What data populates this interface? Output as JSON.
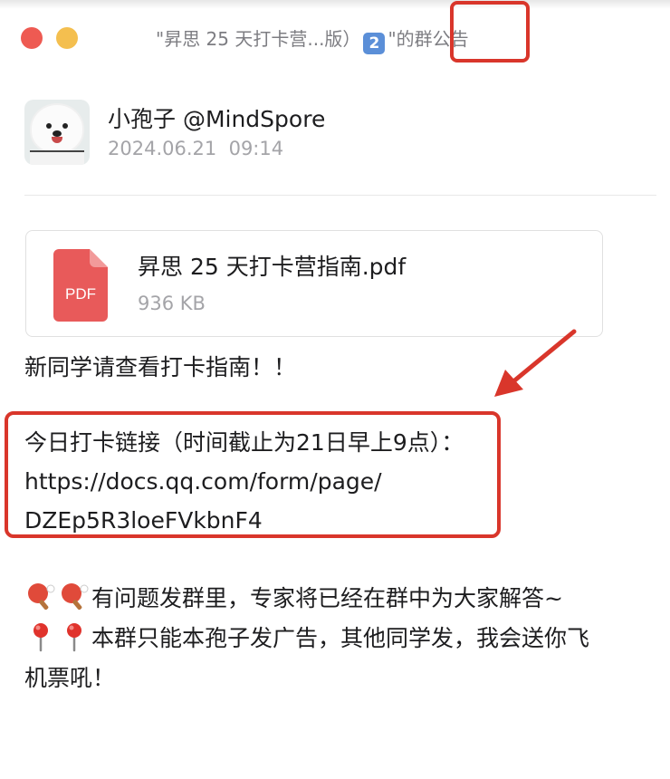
{
  "window": {
    "title_prefix": "\"昇思 25 天打卡营...版）",
    "title_keycap": "2",
    "title_suffix_quote": "\"的",
    "title_suffix_highlight": "群公告"
  },
  "author": {
    "name": "小孢子 @MindSpore",
    "timestamp": "2024.06.21  09:14",
    "avatar_icon": "samoyed-dog-avatar"
  },
  "attachment": {
    "icon": "pdf-file-icon",
    "icon_label": "PDF",
    "file_name": "昇思 25 天打卡营指南.pdf",
    "file_size": "936 KB"
  },
  "announcement": {
    "line_1": "新同学请查看打卡指南！！",
    "link_heading": "今日打卡链接（时间截止为21日早上9点）：",
    "link_url_1": "https://docs.qq.com/form/page/",
    "link_url_2": "DZEp5R3loeFVkbnF4",
    "qa_text": "有问题发群里，专家将已经在群中为大家解答~",
    "rule_text_1": "本群只能本孢子发广告，其他同学发，我会送你飞",
    "rule_text_2": "机票吼！",
    "qa_emoji": "ping-pong-emoji",
    "rule_emoji": "round-pushpin-emoji"
  },
  "colors": {
    "highlight": "#d9362b",
    "pdf_red": "#e85a5a",
    "close_button": "#ee5a52",
    "minimize_button": "#f4bf4f",
    "keycap_blue": "#5b8fd8"
  }
}
